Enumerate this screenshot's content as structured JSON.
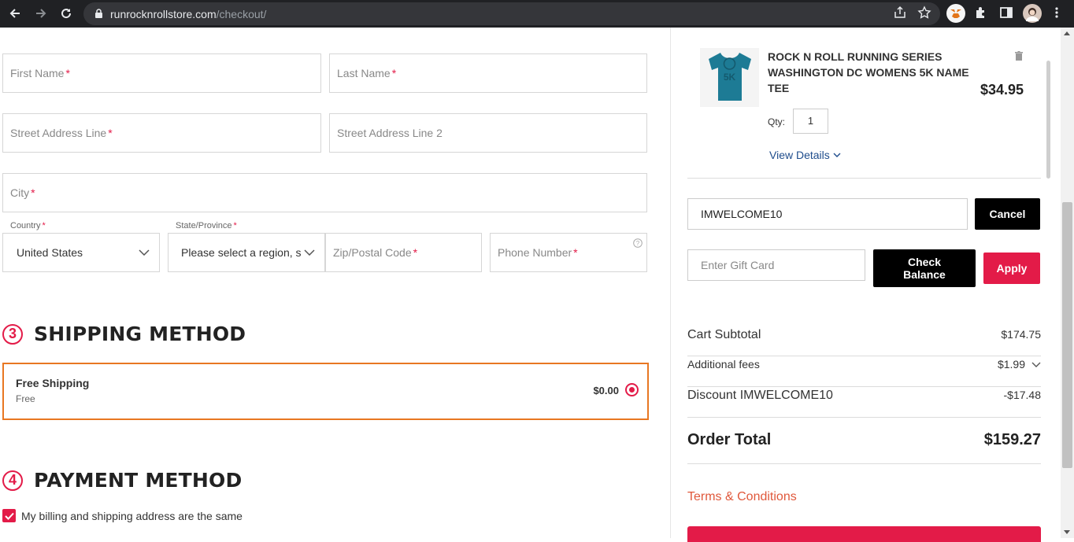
{
  "browser": {
    "url_domain": "runrocknrollstore.com",
    "url_path": "/checkout/"
  },
  "address_form": {
    "first_name_placeholder": "First Name",
    "last_name_placeholder": "Last Name",
    "street1_placeholder": "Street Address Line",
    "street2_placeholder": "Street Address Line 2",
    "city_placeholder": "City",
    "country_label": "Country",
    "country_value": "United States",
    "state_label": "State/Province",
    "state_value": "Please select a region, s",
    "zip_placeholder": "Zip/Postal Code",
    "phone_placeholder": "Phone Number",
    "required_mark": "*"
  },
  "shipping": {
    "step": "3",
    "title": "SHIPPING METHOD",
    "option_name": "Free Shipping",
    "option_sub": "Free",
    "option_price": "$0.00"
  },
  "payment": {
    "step": "4",
    "title": "PAYMENT METHOD",
    "same_address_label": "My billing and shipping address are the same"
  },
  "cart": {
    "product_name": "ROCK N ROLL RUNNING SERIES WASHINGTON DC WOMENS 5K NAME TEE",
    "product_price": "$34.95",
    "qty_label": "Qty:",
    "qty_value": "1",
    "view_details": "View Details",
    "thumb_text": "5K",
    "promo_code": "IMWELCOME10",
    "cancel_label": "Cancel",
    "gift_placeholder": "Enter Gift Card",
    "check_balance_label": "Check Balance",
    "apply_label": "Apply",
    "subtotal_label": "Cart Subtotal",
    "subtotal_value": "$174.75",
    "fees_label": "Additional fees",
    "fees_value": "$1.99",
    "discount_label": "Discount IMWELCOME10",
    "discount_value": "-$17.48",
    "total_label": "Order Total",
    "total_value": "$159.27",
    "terms_label": "Terms & Conditions"
  },
  "colors": {
    "accent_red": "#e31b48",
    "selected_border": "#e87722",
    "link_blue": "#1e4c8c",
    "terms_orange": "#e0583b"
  }
}
